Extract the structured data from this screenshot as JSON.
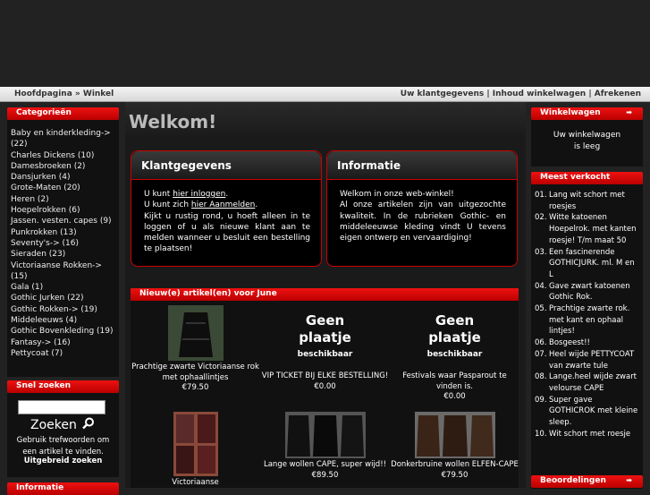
{
  "breadcrumb": {
    "home": "Hoofdpagina",
    "sep": "»",
    "shop": "Winkel"
  },
  "topnav": {
    "account": "Uw klantgegevens",
    "cart": "Inhoud winkelwagen",
    "checkout": "Afrekenen",
    "sep": "|"
  },
  "categories": {
    "title": "Categorieën",
    "items": [
      "Baby en kinderkleding-> (22)",
      "Charles Dickens (10)",
      "Damesbroeken (2)",
      "Dansjurken (4)",
      "Grote-Maten (20)",
      "Heren (2)",
      "Hoepelrokken (6)",
      "Jassen. vesten. capes (9)",
      "Punkrokken (13)",
      "Seventy's-> (16)",
      "Sieraden (23)",
      "Victoriaanse Rokken-> (15)",
      "Gala (1)",
      "Gothic Jurken (22)",
      "Gothic Rokken-> (19)",
      "Middeleeuws (4)",
      "Gothic Bovenkleding (19)",
      "Fantasy-> (16)",
      "Pettycoat (7)"
    ]
  },
  "quicksearch": {
    "title": "Snel zoeken",
    "button": "Zoeken",
    "help": "Gebruik trefwoorden om een artikel te vinden.",
    "advanced": "Uitgebreid zoeken"
  },
  "infobox": {
    "title": "Informatie"
  },
  "main": {
    "welcome": "Welkom!",
    "account_panel": {
      "title": "Klantgegevens",
      "line1_pre": "U kunt ",
      "line1_link": "hier inloggen",
      "line1_post": ".",
      "line2_pre": "U kunt zich ",
      "line2_link": "hier Aanmelden",
      "line2_post": ".",
      "body": "Kijkt u rustig rond, u hoeft alleen in te loggen of u als nieuwe klant aan te melden wanneer u besluit een bestelling te plaatsen!"
    },
    "info_panel": {
      "title": "Informatie",
      "line1": "Welkom in onze web-winkel!",
      "body": "Al onze artikelen zijn van uitgezochte kwaliteit. In de rubrieken Gothic- en middeleeuwse kleding vindt U tevens eigen ontwerp en vervaardiging!"
    },
    "new_products": {
      "title": "Nieuw(e) artikel(en) voor June",
      "noimg_line1": "Geen",
      "noimg_line2": "plaatje",
      "noimg_line3": "beschikbaar",
      "items": [
        {
          "name": "Prachtige zwarte Victoriaanse rok met ophaallintjes",
          "price": "€79.50"
        },
        {
          "name": "VIP TICKET BIJ ELKE BESTELLING!",
          "price": "€0.00"
        },
        {
          "name": "Festivals waar Pasparout te vinden is.",
          "price": "€0.00"
        },
        {
          "name": "Victoriaanse",
          "price": ""
        },
        {
          "name": "Lange wollen CAPE, super wijd!!",
          "price": "€89.50"
        },
        {
          "name": "Donkerbruine wollen ELFEN-CAPE",
          "price": "€79.50"
        }
      ]
    }
  },
  "cart": {
    "title": "Winkelwagen",
    "empty_line1": "Uw winkelwagen",
    "empty_line2": "is leeg"
  },
  "bestsellers": {
    "title": "Meest verkocht",
    "items": [
      {
        "n": "01.",
        "t": "Lang wit schort met roesjes"
      },
      {
        "n": "02.",
        "t": "Witte katoenen Hoepelrok. met kanten roesje! T/m maat 50"
      },
      {
        "n": "03.",
        "t": "Een fascinerende GOTHICJURK. ml. M en L"
      },
      {
        "n": "04.",
        "t": "Gave zwart katoenen Gothic Rok."
      },
      {
        "n": "05.",
        "t": "Prachtige zwarte rok. met kant en ophaal lintjes!"
      },
      {
        "n": "06.",
        "t": "Bosgeest!!"
      },
      {
        "n": "07.",
        "t": "Heel wijde PETTYCOAT van zwarte tule"
      },
      {
        "n": "08.",
        "t": "Lange.heel wijde zwart velourse CAPE"
      },
      {
        "n": "09.",
        "t": "Super gave GOTHICROK met kleine sleep."
      },
      {
        "n": "10.",
        "t": "Wit schort met roesje"
      }
    ]
  },
  "reviews": {
    "title": "Beoordelingen"
  },
  "colors": {
    "accent": "#cc0000",
    "background": "#222222",
    "panel": "#000000"
  }
}
